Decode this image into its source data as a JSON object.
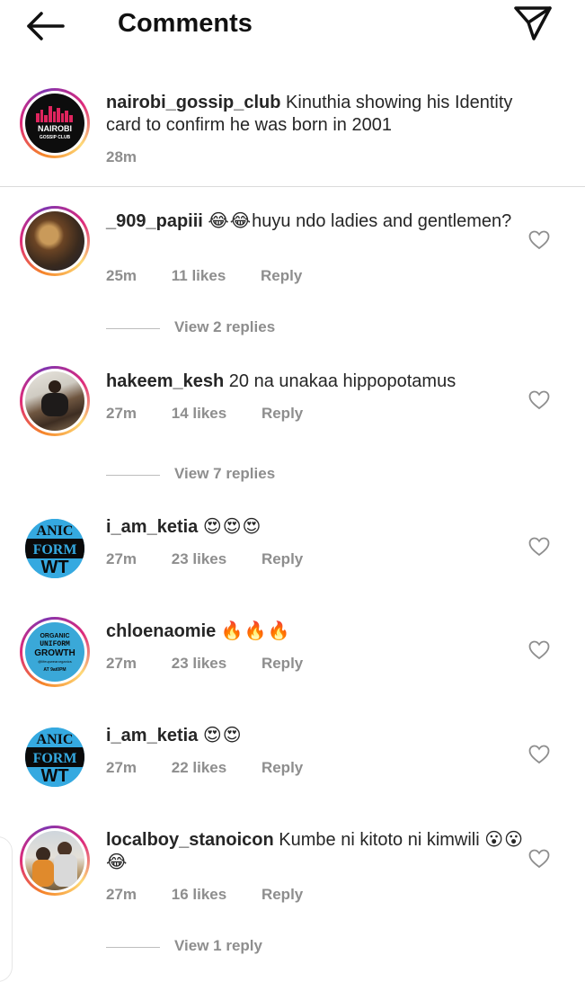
{
  "header": {
    "title": "Comments"
  },
  "caption": {
    "username": "nairobi_gossip_club",
    "text": "Kinuthia showing his Identity card to confirm he was born in 2001",
    "time": "28m",
    "avatar_lines": [
      "NAIROBI",
      "GOSSIP CLUB"
    ]
  },
  "comments": [
    {
      "username": "_909_papiii",
      "emoji": "😂😂",
      "text": "huyu ndo ladies and gentlemen?",
      "time": "25m",
      "likes": "11 likes",
      "reply": "Reply",
      "view_replies": "View 2 replies"
    },
    {
      "username": "hakeem_kesh",
      "text": "20 na unakaa hippopotamus",
      "time": "27m",
      "likes": "14 likes",
      "reply": "Reply",
      "view_replies": "View 7 replies"
    },
    {
      "username": "i_am_ketia",
      "emoji": "😍😍😍",
      "time": "27m",
      "likes": "23 likes",
      "reply": "Reply"
    },
    {
      "username": "chloenaomie",
      "emoji": "🔥🔥🔥",
      "time": "27m",
      "likes": "23 likes",
      "reply": "Reply",
      "avatar_lines": [
        "ORGANIC",
        "UNIFORM",
        "GROWTH",
        "@lifeupwearorganics",
        "AT 9at0PM"
      ]
    },
    {
      "username": "i_am_ketia",
      "emoji": "😍😍",
      "time": "27m",
      "likes": "22 likes",
      "reply": "Reply"
    },
    {
      "username": "localboy_stanoicon",
      "text": "Kumbe ni kitoto ni kimwili",
      "emoji": "😮😮😂",
      "time": "27m",
      "likes": "16 likes",
      "reply": "Reply",
      "view_replies": "View 1 reply"
    }
  ],
  "ketia_avatar_lines": [
    "ANIC",
    "FORM",
    "WT"
  ],
  "icons": {
    "back": "arrow-left-icon",
    "send": "paper-plane-icon",
    "like": "heart-outline-icon"
  },
  "colors": {
    "text": "#262626",
    "meta": "#8e8e8e",
    "divider": "#dbdbdb",
    "avatar_blue": "#35a9e0"
  }
}
